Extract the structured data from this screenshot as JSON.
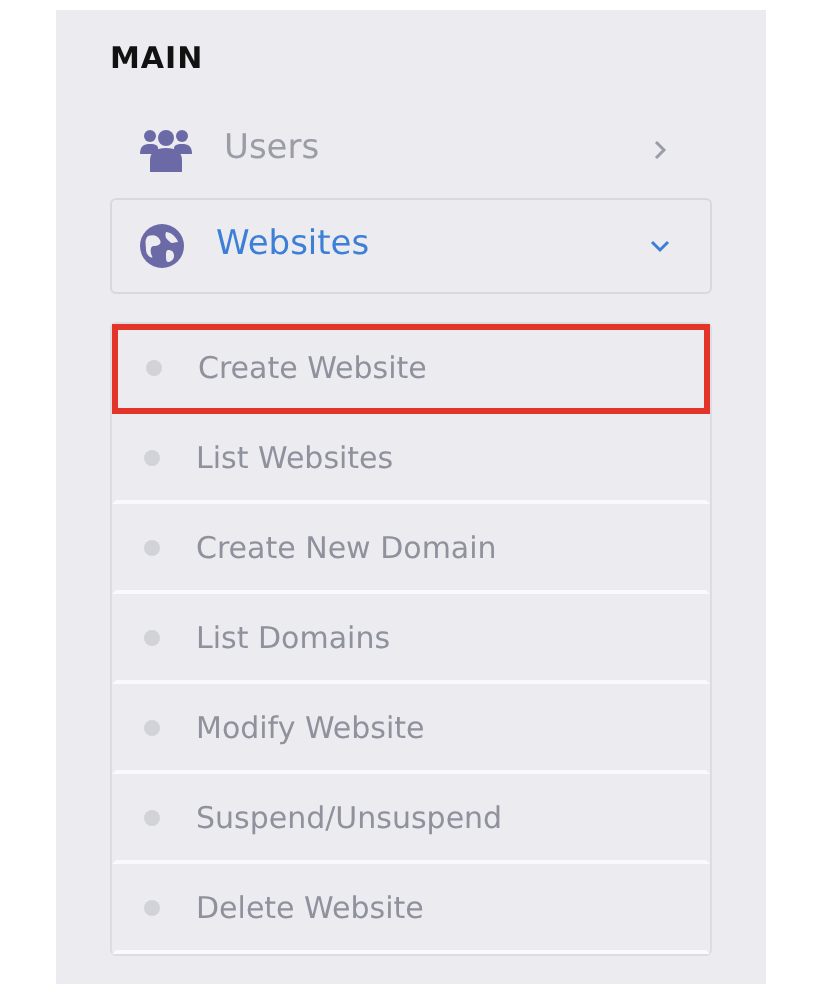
{
  "section_title": "MAIN",
  "menu": [
    {
      "label": "Users",
      "expanded": false,
      "selected": false
    },
    {
      "label": "Websites",
      "expanded": true,
      "selected": true,
      "children": [
        {
          "label": "Create Website",
          "highlighted": true
        },
        {
          "label": "List Websites",
          "highlighted": false
        },
        {
          "label": "Create New Domain",
          "highlighted": false
        },
        {
          "label": "List Domains",
          "highlighted": false
        },
        {
          "label": "Modify Website",
          "highlighted": false
        },
        {
          "label": "Suspend/Unsuspend",
          "highlighted": false
        },
        {
          "label": "Delete Website",
          "highlighted": false
        }
      ]
    }
  ]
}
